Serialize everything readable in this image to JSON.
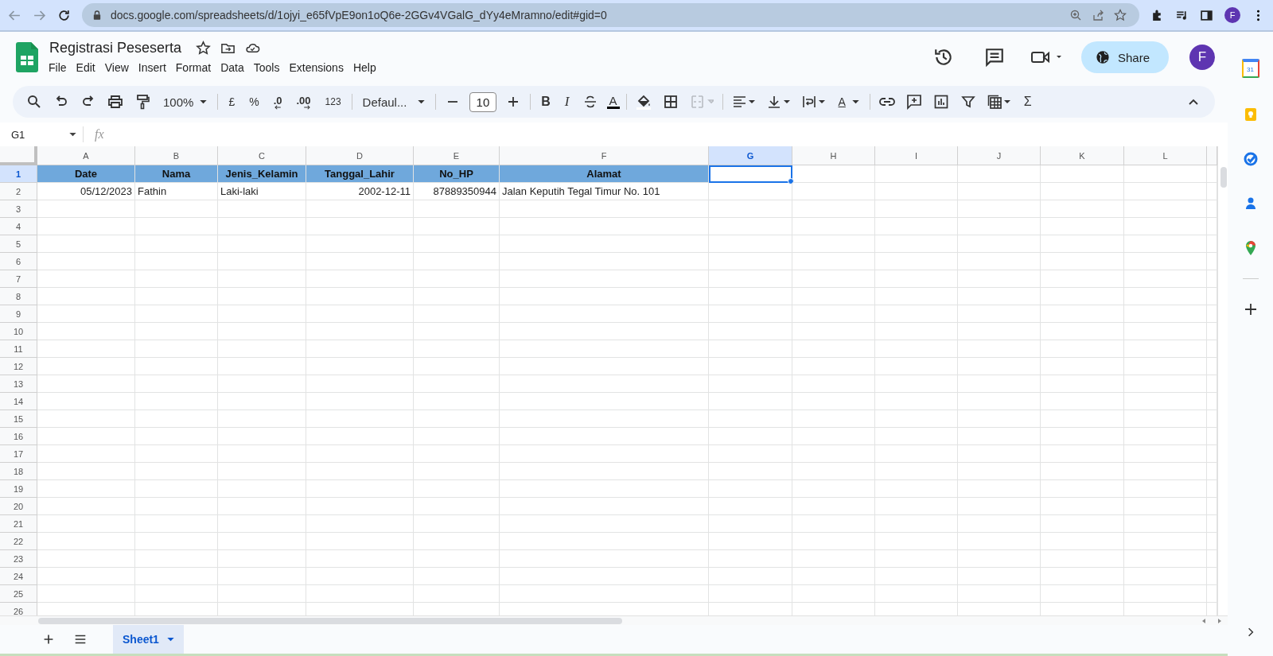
{
  "browser": {
    "url": "docs.google.com/spreadsheets/d/1ojyi_e65fVpE9on1oQ6e-2GGv4VGalG_dYy4eMramno/edit#gid=0",
    "profile_initial": "F"
  },
  "document": {
    "title": "Registrasi Peseserta"
  },
  "menu": [
    "File",
    "Edit",
    "View",
    "Insert",
    "Format",
    "Data",
    "Tools",
    "Extensions",
    "Help"
  ],
  "header": {
    "share_label": "Share",
    "account_initial": "F"
  },
  "toolbar": {
    "zoom": "100%",
    "currency": "£",
    "percent": "%",
    "decrease_decimals": ".0",
    "increase_decimals": ".00",
    "number_format": "123",
    "font": "Defaul...",
    "font_size": "10",
    "bold": "B",
    "italic": "I",
    "text_color": "A",
    "text_rotation": "A",
    "sum": "Σ"
  },
  "formula_bar": {
    "name_box": "G1",
    "fx": "fx"
  },
  "columns": [
    {
      "letter": "A",
      "selected": false
    },
    {
      "letter": "B",
      "selected": false
    },
    {
      "letter": "C",
      "selected": false
    },
    {
      "letter": "D",
      "selected": false
    },
    {
      "letter": "E",
      "selected": false
    },
    {
      "letter": "F",
      "selected": false
    },
    {
      "letter": "G",
      "selected": true
    },
    {
      "letter": "H",
      "selected": false
    },
    {
      "letter": "I",
      "selected": false
    },
    {
      "letter": "J",
      "selected": false
    },
    {
      "letter": "K",
      "selected": false
    },
    {
      "letter": "L",
      "selected": false
    }
  ],
  "rows": [
    {
      "number": "1",
      "selected": true,
      "cells": [
        {
          "text": "Date",
          "kind": "header"
        },
        {
          "text": "Nama",
          "kind": "header"
        },
        {
          "text": "Jenis_Kelamin",
          "kind": "header"
        },
        {
          "text": "Tanggal_Lahir",
          "kind": "header"
        },
        {
          "text": "No_HP",
          "kind": "header"
        },
        {
          "text": "Alamat",
          "kind": "header"
        }
      ]
    },
    {
      "number": "2",
      "selected": false,
      "cells": [
        {
          "text": "05/12/2023",
          "kind": "number"
        },
        {
          "text": "Fathin",
          "kind": "text"
        },
        {
          "text": "Laki-laki",
          "kind": "text"
        },
        {
          "text": "2002-12-11",
          "kind": "number"
        },
        {
          "text": "87889350944",
          "kind": "number"
        },
        {
          "text": "Jalan Keputih Tegal Timur No. 101",
          "kind": "text"
        }
      ]
    },
    {
      "number": "3",
      "selected": false
    },
    {
      "number": "4",
      "selected": false
    },
    {
      "number": "5",
      "selected": false
    },
    {
      "number": "6",
      "selected": false
    },
    {
      "number": "7",
      "selected": false
    },
    {
      "number": "8",
      "selected": false
    },
    {
      "number": "9",
      "selected": false
    },
    {
      "number": "10",
      "selected": false
    },
    {
      "number": "11",
      "selected": false
    },
    {
      "number": "12",
      "selected": false
    },
    {
      "number": "13",
      "selected": false
    },
    {
      "number": "14",
      "selected": false
    },
    {
      "number": "15",
      "selected": false
    },
    {
      "number": "16",
      "selected": false
    },
    {
      "number": "17",
      "selected": false
    },
    {
      "number": "18",
      "selected": false
    },
    {
      "number": "19",
      "selected": false
    },
    {
      "number": "20",
      "selected": false
    },
    {
      "number": "21",
      "selected": false
    },
    {
      "number": "22",
      "selected": false
    },
    {
      "number": "23",
      "selected": false
    },
    {
      "number": "24",
      "selected": false
    },
    {
      "number": "25",
      "selected": false
    },
    {
      "number": "26",
      "selected": false
    }
  ],
  "sheet_tabs": [
    {
      "label": "Sheet1",
      "selected": true
    }
  ],
  "side_panel": {
    "calendar_day": "31"
  }
}
